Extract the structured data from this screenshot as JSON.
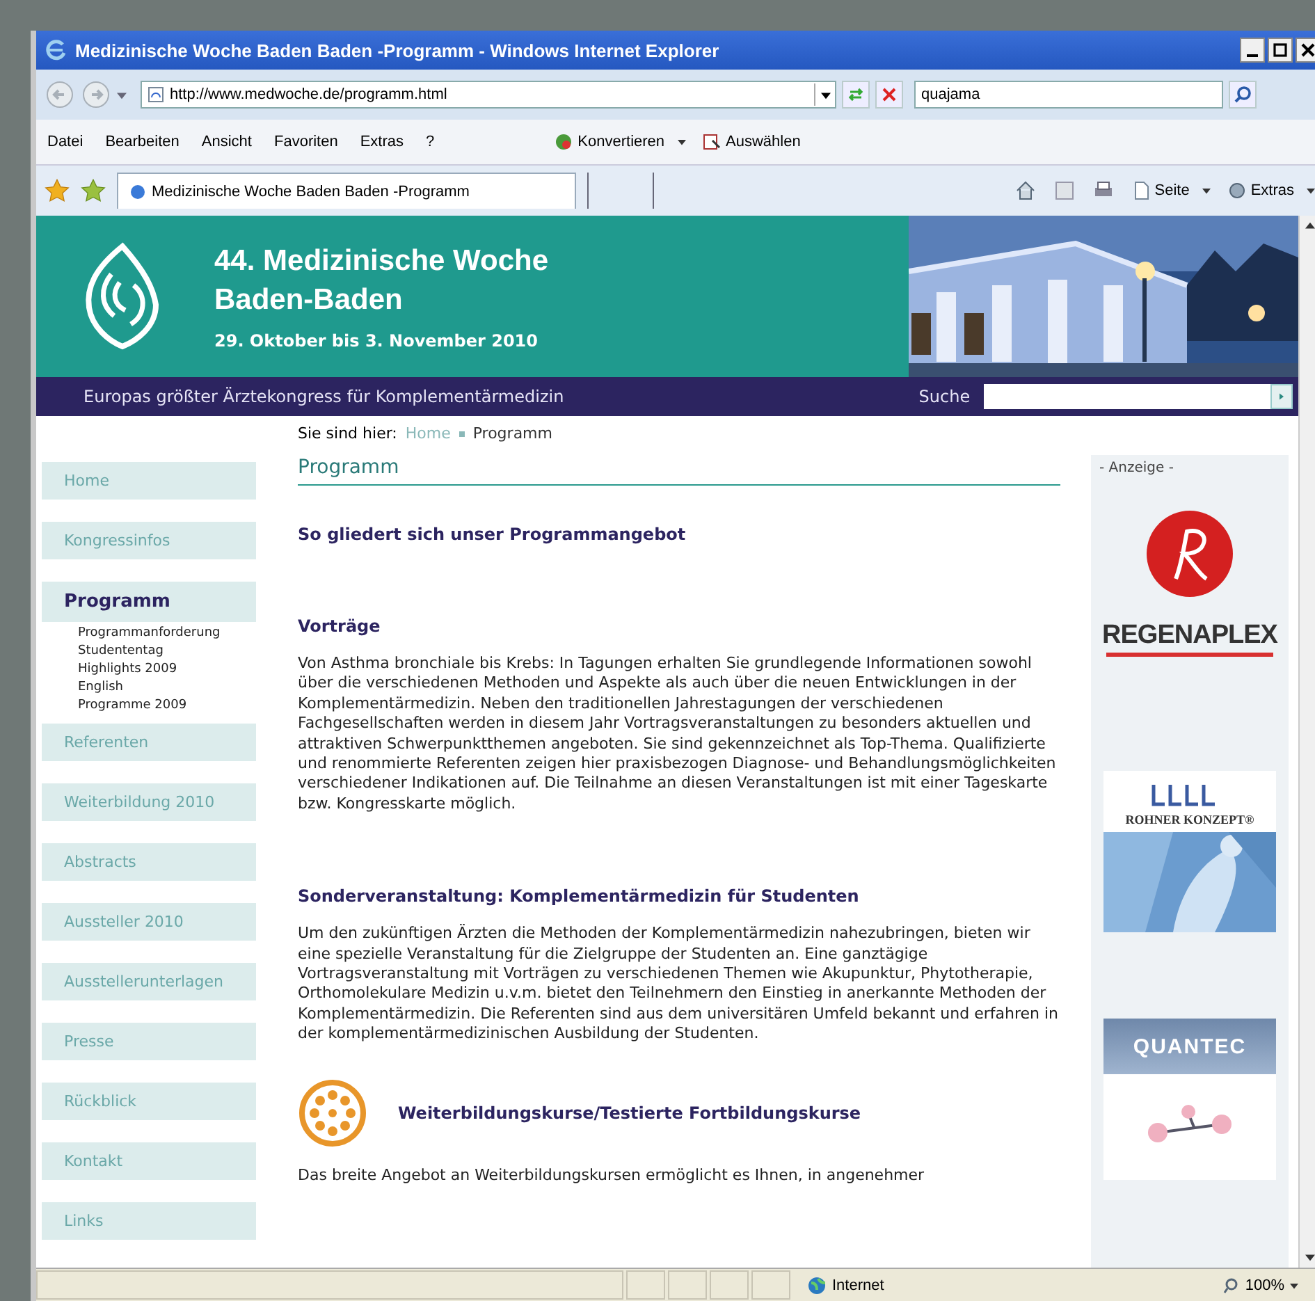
{
  "window": {
    "title": "Medizinische Woche Baden Baden -Programm - Windows Internet Explorer"
  },
  "address_bar": {
    "url": "http://www.medwoche.de/programm.html",
    "search_value": "quajama"
  },
  "menu": [
    "Datei",
    "Bearbeiten",
    "Ansicht",
    "Favoriten",
    "Extras",
    "?"
  ],
  "toolbar_buttons": [
    {
      "label": "Konvertieren"
    },
    {
      "label": "Auswählen"
    }
  ],
  "tab": {
    "title": "Medizinische Woche Baden Baden -Programm",
    "selected": true
  },
  "command_bar": [
    {
      "label": "Seite"
    },
    {
      "label": "Extras"
    }
  ],
  "header": {
    "title_line_1": "44. Medizinische Woche",
    "title_line_2": "Baden-Baden",
    "dates": "29. Oktober bis 3. November 2010",
    "tagline": "Europas größter Ärztekongress für Komplementärmedizin",
    "search_label": "Suche"
  },
  "breadcrumb": {
    "prefix": "Sie sind hier:",
    "items": [
      "Home",
      "Programm"
    ]
  },
  "sidebar": [
    {
      "label": "Home",
      "selected": false
    },
    {
      "label": "Kongressinfos",
      "selected": false
    },
    {
      "label": "Programm",
      "selected": true,
      "children": [
        "Programmanforderung",
        "Studententag",
        "Highlights 2009",
        "English",
        "Programme 2009"
      ]
    },
    {
      "label": "Referenten",
      "selected": false
    },
    {
      "label": "Weiterbildung 2010",
      "selected": false
    },
    {
      "label": "Abstracts",
      "selected": false
    },
    {
      "label": "Aussteller 2010",
      "selected": false
    },
    {
      "label": "Ausstellerunterlagen",
      "selected": false
    },
    {
      "label": "Presse",
      "selected": false
    },
    {
      "label": "Rückblick",
      "selected": false
    },
    {
      "label": "Kontakt",
      "selected": false
    },
    {
      "label": "Links",
      "selected": false
    }
  ],
  "main": {
    "title": "Programm",
    "intro": "So gliedert sich unser Programmangebot",
    "sections": [
      {
        "heading": "Vorträge",
        "text": "Von Asthma bronchiale bis Krebs: In Tagungen erhalten Sie grundlegende Informationen sowohl über die verschiedenen Methoden und Aspekte als auch über die neuen Entwicklungen in der Komplementärmedizin. Neben den traditionellen Jahrestagungen der verschiedenen Fachgesellschaften werden in diesem Jahr Vortragsveranstaltungen zu besonders aktuellen und attraktiven Schwerpunktthemen angeboten. Sie sind gekennzeichnet als Top-Thema. Qualifizierte und renommierte Referenten zeigen hier praxisbezogen Diagnose- und Behandlungsmöglichkeiten verschiedener Indikationen auf. Die Teilnahme an diesen Veranstaltungen ist mit einer Tageskarte bzw. Kongresskarte möglich.",
        "icon": false
      },
      {
        "heading": "Sonderveranstaltung: Komplementärmedizin für Studenten",
        "text": "Um den zukünftigen Ärzten die Methoden der Komplementärmedizin nahezubringen, bieten wir eine spezielle Veranstaltung für die Zielgruppe der Studenten an. Eine ganztägige Vortragsveranstaltung mit Vorträgen zu verschiedenen Themen wie Akupunktur, Phytotherapie, Orthomolekulare Medizin u.v.m. bietet den Teilnehmern den Einstieg in anerkannte Methoden der Komplementärmedizin. Die Referenten sind aus dem universitären Umfeld bekannt und erfahren in der komplementärmedizinischen Ausbildung der Studenten.",
        "icon": false
      },
      {
        "heading": "Weiterbildungskurse/Testierte Fortbildungskurse",
        "text": "Das breite Angebot an Weiterbildungskursen ermöglicht es Ihnen, in angenehmer",
        "icon": true
      }
    ]
  },
  "ads": {
    "label": "- Anzeige -",
    "brands": [
      "REGENAPLEX",
      "ROHNER KONZEPT®",
      "QUANTEC"
    ]
  },
  "status_bar": {
    "zone": "Internet",
    "zoom": "100%"
  }
}
